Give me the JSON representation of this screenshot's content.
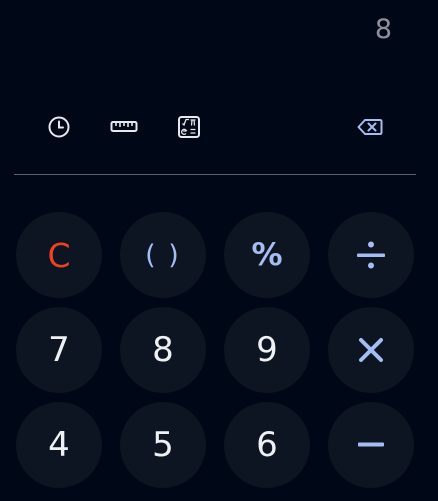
{
  "display": {
    "value": "8"
  },
  "toolbar": {
    "history_icon": "history-icon",
    "unit_converter_icon": "ruler-icon",
    "scientific_icon": "scientific-functions-icon",
    "backspace_icon": "backspace-icon"
  },
  "keypad": {
    "row1": [
      "C",
      "( )",
      "%",
      "÷"
    ],
    "row2": [
      "7",
      "8",
      "9",
      "×"
    ],
    "row3": [
      "4",
      "5",
      "6",
      "−"
    ]
  },
  "colors": {
    "background": "#000716",
    "key_background": "#0d1422",
    "operator": "#a6bdf2",
    "clear": "#ef3f26",
    "digit": "#eef0f4",
    "display_text": "#8c919c",
    "toolbar_icon": "#e6e8ee",
    "backspace_icon_color": "#a6bdf2"
  }
}
